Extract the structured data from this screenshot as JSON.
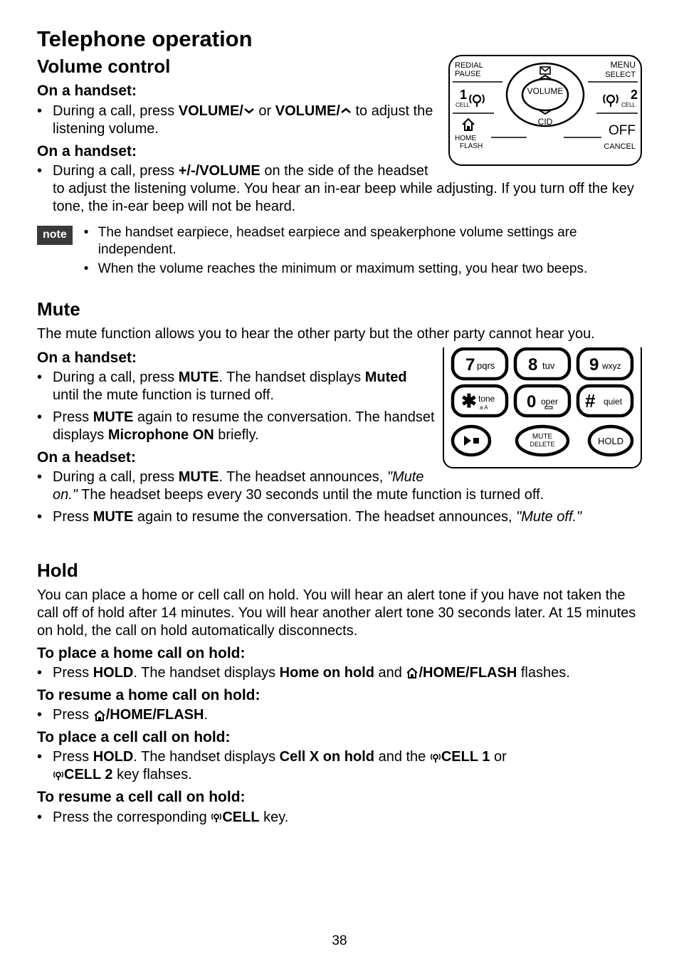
{
  "page_number": "38",
  "title": "Telephone operation",
  "sections": {
    "volume": {
      "heading": "Volume control",
      "sub1": "On a handset:",
      "b1_pre": "During a call, press ",
      "b1_vol1": "VOLUME/",
      "b1_or": " or ",
      "b1_vol2": "VOLUME/",
      "b1_post": " to adjust the listening volume.",
      "sub2": "On a handset:",
      "b2_pre": "During a call, press ",
      "b2_key": "+/-/VOLUME",
      "b2_post": " on the side of the headset to adjust the listening volume. You hear an in-ear beep while adjusting. If you turn off the key tone, the in-ear beep will not be heard.",
      "note_label": "note",
      "note1": "The handset earpiece, headset earpiece and speakerphone volume settings are independent.",
      "note2": "When the volume reaches the minimum or maximum setting, you hear two beeps."
    },
    "mute": {
      "heading": "Mute",
      "intro": "The mute function allows you to hear the other party but the other party cannot hear you.",
      "sub1": "On a handset:",
      "m1a_pre": "During a call, press ",
      "m1a_mute": "MUTE",
      "m1a_mid": ". The handset displays ",
      "m1a_muted": "Muted",
      "m1a_post": " until the mute function is turned off.",
      "m1b_pre": "Press ",
      "m1b_mute": "MUTE",
      "m1b_mid": " again to resume the conversation. The handset displays ",
      "m1b_mic": "Microphone ON",
      "m1b_post": " briefly.",
      "sub2": "On a headset:",
      "m2a_pre": "During a call, press ",
      "m2a_mute": "MUTE",
      "m2a_mid": ". The headset announces, ",
      "m2a_quote": "\"Mute on.\"",
      "m2a_post": " The headset beeps every 30 seconds until the mute function is turned off.",
      "m2b_pre": "Press ",
      "m2b_mute": "MUTE",
      "m2b_mid": " again to resume the conversation. The headset announces, ",
      "m2b_quote": "\"Mute off.\""
    },
    "hold": {
      "heading": "Hold",
      "intro": "You can place a home or cell call on hold. You will hear an alert tone if you have not taken the call off of hold after 14 minutes. You will hear another alert tone 30 seconds later. At 15 minutes on hold, the call on hold automatically disconnects.",
      "sub1": "To place a home call on hold:",
      "h1_pre": "Press ",
      "h1_hold": "HOLD",
      "h1_mid": ". The handset displays ",
      "h1_disp": "Home on hold",
      "h1_and": " and ",
      "h1_key": "/HOME/FLASH",
      "h1_post": " flashes.",
      "sub2": "To resume a home call on hold:",
      "h2_pre": "Press ",
      "h2_key": "/HOME/FLASH",
      "h2_post": ".",
      "sub3": "To place a cell call on hold:",
      "h3_pre": "Press ",
      "h3_hold": "HOLD",
      "h3_mid": ". The handset displays ",
      "h3_disp": "Cell X on hold",
      "h3_and": " and the ",
      "h3_cell1": "CELL 1",
      "h3_or": " or ",
      "h3_cell2": "CELL 2",
      "h3_post": " key flahses.",
      "sub4": "To resume a cell call on hold:",
      "h4_pre": "Press the corresponding ",
      "h4_cell": "CELL",
      "h4_post": " key."
    }
  },
  "fig1": {
    "redial": "REDIAL",
    "pause": "PAUSE",
    "menu": "MENU",
    "select": "SELECT",
    "volume": "VOLUME",
    "cid": "CID",
    "one": "1",
    "cell_l": "CELL",
    "two": "2",
    "cell_r": "CELL",
    "home": "HOME",
    "flash": "FLASH",
    "off": "OFF",
    "cancel": "CANCEL"
  },
  "fig2": {
    "k7n": "7",
    "k7t": "pqrs",
    "k8n": "8",
    "k8t": "tuv",
    "k9n": "9",
    "k9t": "wxyz",
    "kst": "tone",
    "ksb": "a A",
    "k0n": "0",
    "k0t": "oper",
    "kht": "quiet",
    "mute": "MUTE",
    "delete": "DELETE",
    "hold": "HOLD"
  }
}
